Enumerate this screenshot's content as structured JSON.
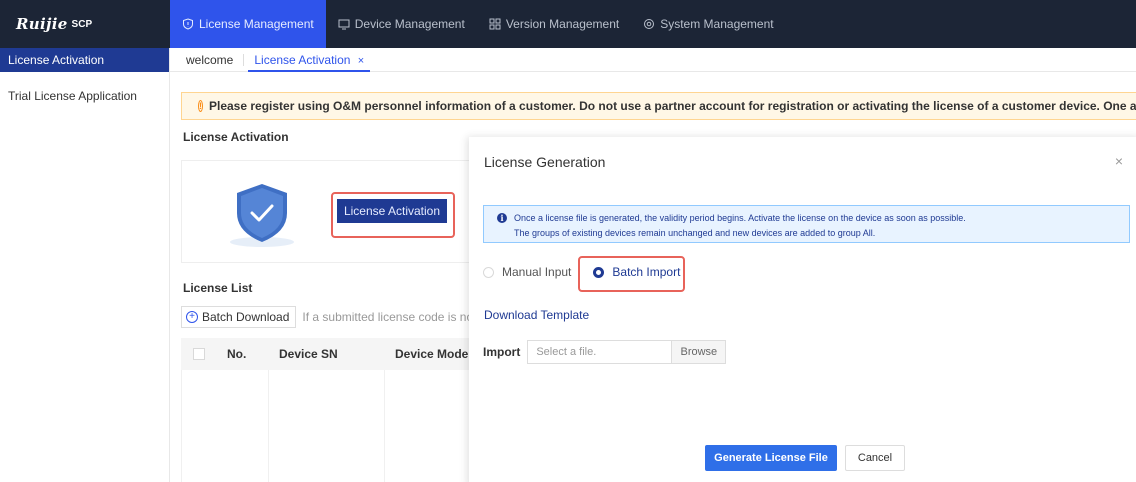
{
  "brand": {
    "logo": "Ruijie",
    "product": "SCP"
  },
  "nav": [
    {
      "label": "License Management",
      "icon": "shield-icon",
      "active": true
    },
    {
      "label": "Device Management",
      "icon": "monitor-icon"
    },
    {
      "label": "Version Management",
      "icon": "grid-icon"
    },
    {
      "label": "System Management",
      "icon": "settings-icon"
    }
  ],
  "sidebar": {
    "items": [
      {
        "label": "License Activation"
      },
      {
        "label": "Trial License Application"
      }
    ]
  },
  "tabs": {
    "welcome": "welcome",
    "active": "License Activation",
    "close": "×"
  },
  "notice": "Please register using O&M personnel information of a customer. Do not use a partner account for registration or activating the license of a customer device. One account can be",
  "activation": {
    "title": "License Activation",
    "button": "License Activation"
  },
  "license_list": {
    "title": "License List",
    "batch_download": "Batch Download",
    "hint": "If a submitted license code is not sh",
    "columns": [
      "No.",
      "Device SN",
      "Device Model"
    ]
  },
  "dialog": {
    "title": "License Generation",
    "close": "×",
    "info_line1": "Once a license file is generated, the validity period begins. Activate the license on the device as soon as possible.",
    "info_line2": "The groups of existing devices remain unchanged and new devices are added to group All.",
    "radio_manual": "Manual Input",
    "radio_batch": "Batch Import",
    "selected": "Batch Import",
    "download_template": "Download Template",
    "import_label": "Import",
    "file_placeholder": "Select a file.",
    "browse": "Browse",
    "generate": "Generate License File",
    "cancel": "Cancel"
  },
  "colors": {
    "nav_bg": "#1c2536",
    "accent": "#2f54eb",
    "primary_dark": "#1f3a93",
    "highlight": "#e8635a"
  }
}
